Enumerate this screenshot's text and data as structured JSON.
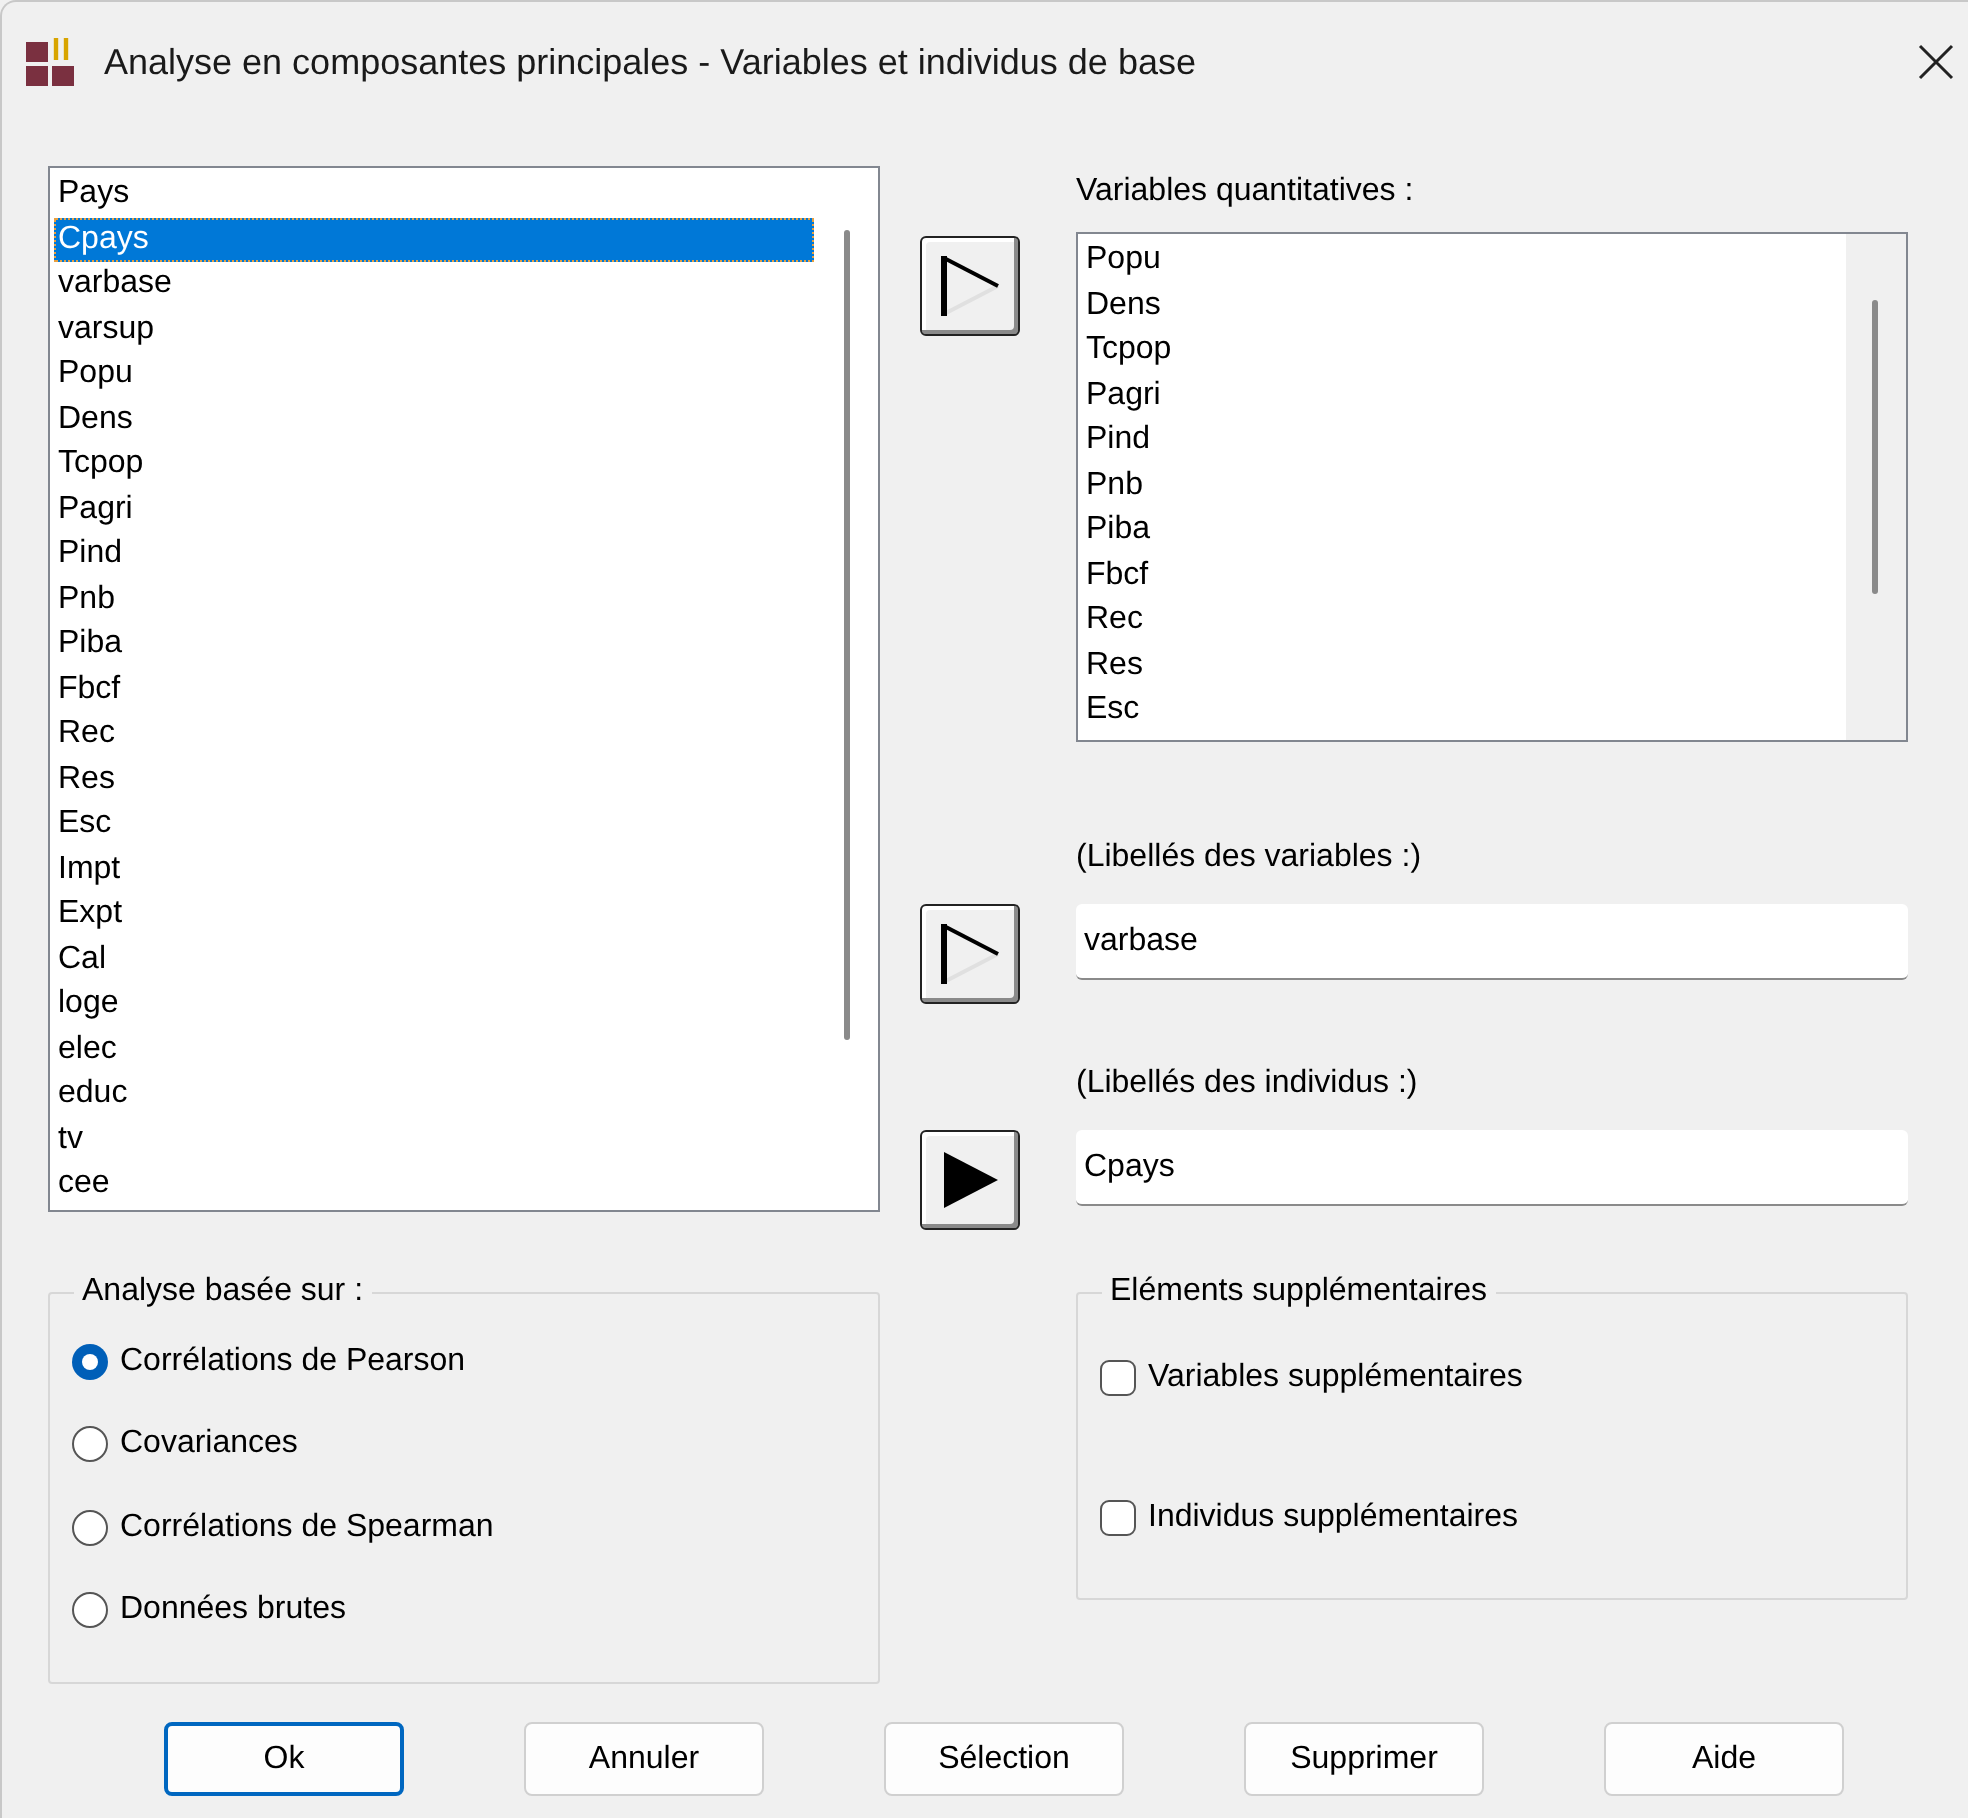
{
  "window": {
    "title": "Analyse en composantes principales - Variables et individus de base"
  },
  "source_list": {
    "items": [
      {
        "label": "Pays",
        "selected": false
      },
      {
        "label": "Cpays",
        "selected": true
      },
      {
        "label": "varbase",
        "selected": false
      },
      {
        "label": "varsup",
        "selected": false
      },
      {
        "label": "Popu",
        "selected": false
      },
      {
        "label": "Dens",
        "selected": false
      },
      {
        "label": "Tcpop",
        "selected": false
      },
      {
        "label": "Pagri",
        "selected": false
      },
      {
        "label": "Pind",
        "selected": false
      },
      {
        "label": "Pnb",
        "selected": false
      },
      {
        "label": "Piba",
        "selected": false
      },
      {
        "label": "Fbcf",
        "selected": false
      },
      {
        "label": "Rec",
        "selected": false
      },
      {
        "label": "Res",
        "selected": false
      },
      {
        "label": "Esc",
        "selected": false
      },
      {
        "label": "Impt",
        "selected": false
      },
      {
        "label": "Expt",
        "selected": false
      },
      {
        "label": "Cal",
        "selected": false
      },
      {
        "label": "loge",
        "selected": false
      },
      {
        "label": "elec",
        "selected": false
      },
      {
        "label": "educ",
        "selected": false
      },
      {
        "label": "tv",
        "selected": false
      },
      {
        "label": "cee",
        "selected": false
      }
    ]
  },
  "quantitative": {
    "label": "Variables quantitatives :",
    "button": {
      "filled": false
    },
    "items": [
      "Popu",
      "Dens",
      "Tcpop",
      "Pagri",
      "Pind",
      "Pnb",
      "Piba",
      "Fbcf",
      "Rec",
      "Res",
      "Esc"
    ]
  },
  "variable_labels": {
    "label": "(Libellés des variables :)",
    "button": {
      "filled": false
    },
    "value": "varbase"
  },
  "individual_labels": {
    "label": "(Libellés des individus :)",
    "button": {
      "filled": true
    },
    "value": "Cpays"
  },
  "analysis_group": {
    "title": "Analyse basée sur :",
    "options": [
      {
        "label": "Corrélations de Pearson",
        "selected": true
      },
      {
        "label": "Covariances",
        "selected": false
      },
      {
        "label": "Corrélations de Spearman",
        "selected": false
      },
      {
        "label": "Données brutes",
        "selected": false
      }
    ]
  },
  "supplementary_group": {
    "title": "Eléments supplémentaires",
    "options": [
      {
        "label": "Variables supplémentaires",
        "checked": false
      },
      {
        "label": "Individus supplémentaires",
        "checked": false
      }
    ]
  },
  "buttons": [
    {
      "label": "Ok",
      "default": true
    },
    {
      "label": "Annuler",
      "default": false
    },
    {
      "label": "Sélection",
      "default": false
    },
    {
      "label": "Supprimer",
      "default": false
    },
    {
      "label": "Aide",
      "default": false
    }
  ]
}
